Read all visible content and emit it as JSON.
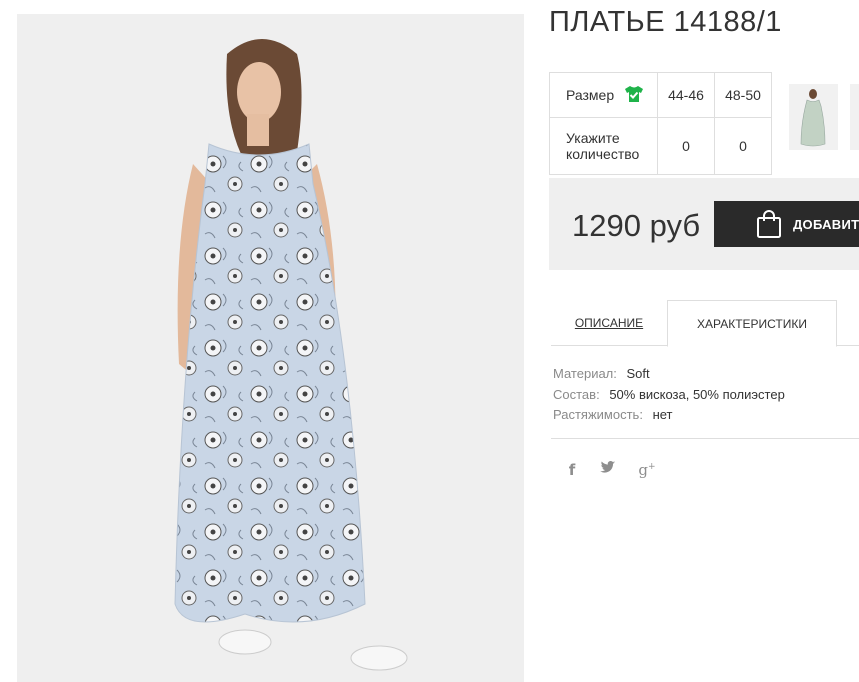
{
  "product": {
    "title": "ПЛАТЬЕ 14188/1",
    "price": "1290 руб",
    "add_button_label": "ДОБАВИТЬ"
  },
  "size_table": {
    "size_label": "Размер",
    "qty_label": "Укажите количество",
    "sizes": [
      "44-46",
      "48-50"
    ],
    "quantities": [
      "0",
      "0"
    ]
  },
  "tabs": {
    "description": "ОПИСАНИЕ",
    "characteristics": "ХАРАКТЕРИСТИКИ",
    "active": "characteristics"
  },
  "specs": [
    {
      "key": "Материал:",
      "value": "Soft"
    },
    {
      "key": "Состав:",
      "value": "50% вискоза, 50% полиэстер"
    },
    {
      "key": "Растяжимость:",
      "value": "нет"
    }
  ],
  "social": {
    "facebook_glyph": "f",
    "gplus_glyph": "g",
    "gplus_sup": "+",
    "icons": [
      "facebook-icon",
      "twitter-icon",
      "google-plus-icon"
    ]
  },
  "colors": {
    "accent_green": "#1fb34a",
    "button_bg": "#2a2a2a",
    "price_box_bg": "#efefef"
  }
}
